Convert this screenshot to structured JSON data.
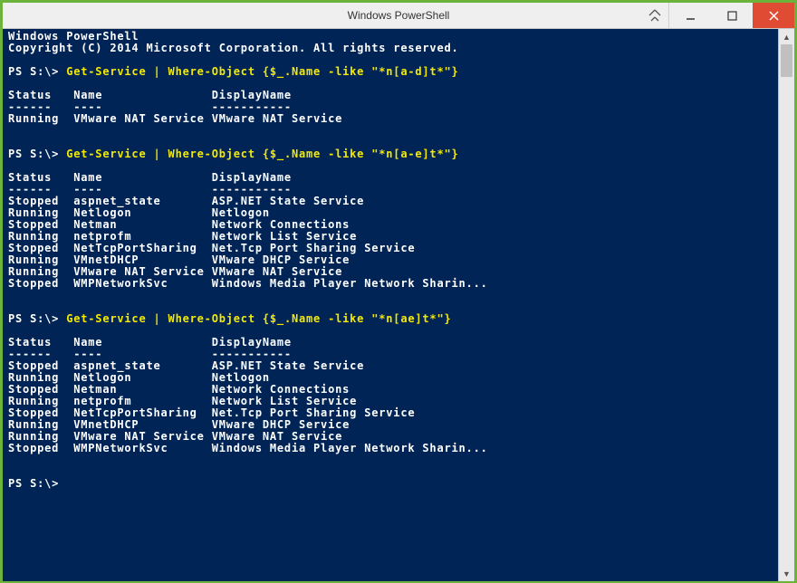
{
  "window": {
    "title": "Windows PowerShell"
  },
  "banner": {
    "line1": "Windows PowerShell",
    "line2": "Copyright (C) 2014 Microsoft Corporation. All rights reserved."
  },
  "blocks": [
    {
      "prompt": "PS S:\\> ",
      "command": "Get-Service | Where-Object {$_.Name -like \"*n[a-d]t*\"}",
      "headers": {
        "status": "Status",
        "name": "Name",
        "display": "DisplayName"
      },
      "dashes": {
        "status": "------",
        "name": "----",
        "display": "-----------"
      },
      "rows": [
        {
          "status": "Running",
          "name": "VMware NAT Service",
          "display": "VMware NAT Service"
        }
      ]
    },
    {
      "prompt": "PS S:\\> ",
      "command": "Get-Service | Where-Object {$_.Name -like \"*n[a-e]t*\"}",
      "headers": {
        "status": "Status",
        "name": "Name",
        "display": "DisplayName"
      },
      "dashes": {
        "status": "------",
        "name": "----",
        "display": "-----------"
      },
      "rows": [
        {
          "status": "Stopped",
          "name": "aspnet_state",
          "display": "ASP.NET State Service"
        },
        {
          "status": "Running",
          "name": "Netlogon",
          "display": "Netlogon"
        },
        {
          "status": "Stopped",
          "name": "Netman",
          "display": "Network Connections"
        },
        {
          "status": "Running",
          "name": "netprofm",
          "display": "Network List Service"
        },
        {
          "status": "Stopped",
          "name": "NetTcpPortSharing",
          "display": "Net.Tcp Port Sharing Service"
        },
        {
          "status": "Running",
          "name": "VMnetDHCP",
          "display": "VMware DHCP Service"
        },
        {
          "status": "Running",
          "name": "VMware NAT Service",
          "display": "VMware NAT Service"
        },
        {
          "status": "Stopped",
          "name": "WMPNetworkSvc",
          "display": "Windows Media Player Network Sharin..."
        }
      ]
    },
    {
      "prompt": "PS S:\\> ",
      "command": "Get-Service | Where-Object {$_.Name -like \"*n[ae]t*\"}",
      "headers": {
        "status": "Status",
        "name": "Name",
        "display": "DisplayName"
      },
      "dashes": {
        "status": "------",
        "name": "----",
        "display": "-----------"
      },
      "rows": [
        {
          "status": "Stopped",
          "name": "aspnet_state",
          "display": "ASP.NET State Service"
        },
        {
          "status": "Running",
          "name": "Netlogon",
          "display": "Netlogon"
        },
        {
          "status": "Stopped",
          "name": "Netman",
          "display": "Network Connections"
        },
        {
          "status": "Running",
          "name": "netprofm",
          "display": "Network List Service"
        },
        {
          "status": "Stopped",
          "name": "NetTcpPortSharing",
          "display": "Net.Tcp Port Sharing Service"
        },
        {
          "status": "Running",
          "name": "VMnetDHCP",
          "display": "VMware DHCP Service"
        },
        {
          "status": "Running",
          "name": "VMware NAT Service",
          "display": "VMware NAT Service"
        },
        {
          "status": "Stopped",
          "name": "WMPNetworkSvc",
          "display": "Windows Media Player Network Sharin..."
        }
      ]
    }
  ],
  "final_prompt": "PS S:\\> "
}
